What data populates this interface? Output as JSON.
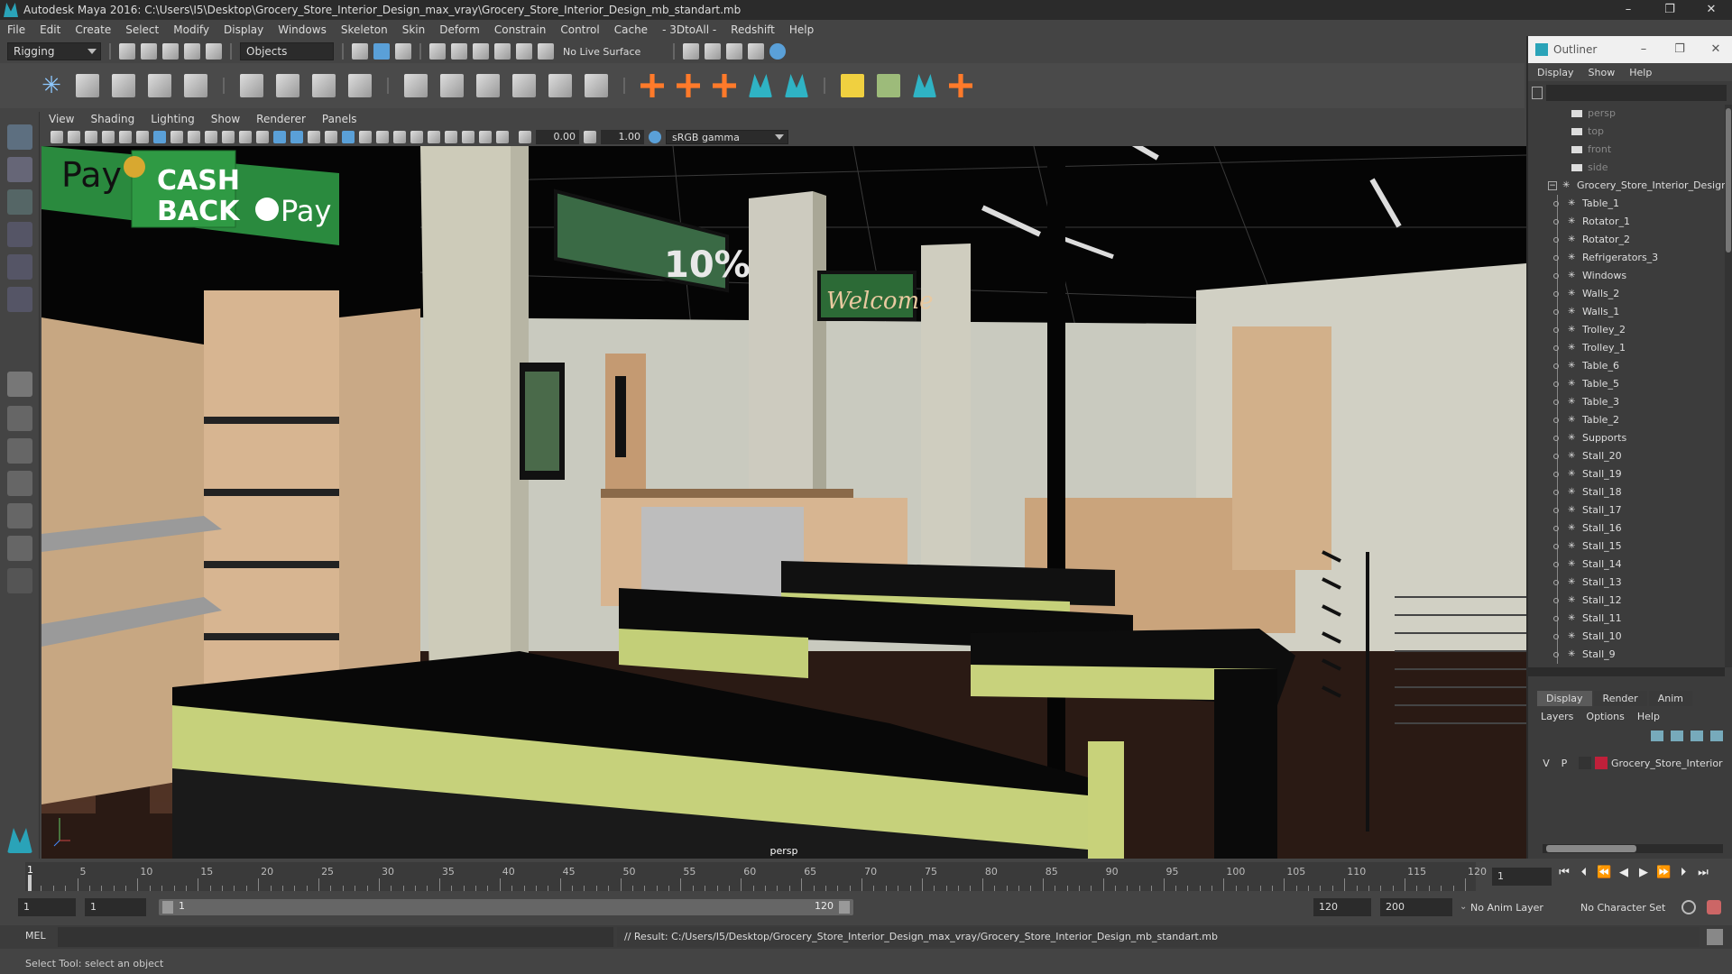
{
  "window": {
    "title": "Autodesk Maya 2016: C:\\Users\\I5\\Desktop\\Grocery_Store_Interior_Design_max_vray\\Grocery_Store_Interior_Design_mb_standart.mb",
    "minimize": "–",
    "maximize": "❐",
    "close": "✕"
  },
  "menubar": [
    "File",
    "Edit",
    "Create",
    "Select",
    "Modify",
    "Display",
    "Windows",
    "Skeleton",
    "Skin",
    "Deform",
    "Constrain",
    "Control",
    "Cache",
    "- 3DtoAll -",
    "Redshift",
    "Help"
  ],
  "statusline": {
    "menuset": "Rigging",
    "selection_mode": "Objects",
    "live_surface": "No Live Surface"
  },
  "viewport": {
    "menu": [
      "View",
      "Shading",
      "Lighting",
      "Show",
      "Renderer",
      "Panels"
    ],
    "exposure": "0.00",
    "gamma": "1.00",
    "color_space": "sRGB gamma",
    "camera_label": "persp",
    "scene_signs": {
      "cash": "CASH",
      "back": "BACK",
      "pay_left": "Pay",
      "gpay": "Pay",
      "percent": "10%",
      "welcome": "Welcome"
    }
  },
  "outliner": {
    "title": "Outliner",
    "menu": [
      "Display",
      "Show",
      "Help"
    ],
    "cameras": [
      "persp",
      "top",
      "front",
      "side"
    ],
    "root": "Grocery_Store_Interior_Design",
    "children": [
      "Table_1",
      "Rotator_1",
      "Rotator_2",
      "Refrigerators_3",
      "Windows",
      "Walls_2",
      "Walls_1",
      "Trolley_2",
      "Trolley_1",
      "Table_6",
      "Table_5",
      "Table_3",
      "Table_2",
      "Supports",
      "Stall_20",
      "Stall_19",
      "Stall_18",
      "Stall_17",
      "Stall_16",
      "Stall_15",
      "Stall_14",
      "Stall_13",
      "Stall_12",
      "Stall_11",
      "Stall_10",
      "Stall_9"
    ]
  },
  "layers": {
    "tabs": [
      "Display",
      "Render",
      "Anim"
    ],
    "menu": [
      "Layers",
      "Options",
      "Help"
    ],
    "row": {
      "v": "V",
      "p": "P",
      "name": "Grocery_Store_Interior"
    }
  },
  "timeline": {
    "ticks": [
      1,
      5,
      10,
      15,
      20,
      25,
      30,
      35,
      40,
      45,
      50,
      55,
      60,
      65,
      70,
      75,
      80,
      85,
      90,
      95,
      100,
      105,
      110,
      115,
      120
    ],
    "labels": [
      "5",
      "10",
      "15",
      "20",
      "25",
      "30",
      "35",
      "40",
      "45",
      "50",
      "55",
      "60",
      "65",
      "70",
      "75",
      "80",
      "85",
      "90",
      "95",
      "100",
      "105",
      "110",
      "115",
      "120"
    ],
    "current_frame_marker": "1",
    "current_frame": "1"
  },
  "range": {
    "start": "1",
    "playback_start": "1",
    "slider_start": "1",
    "slider_end": "120",
    "playback_end": "120",
    "end": "200",
    "anim_layer": "No Anim Layer",
    "character_set": "No Character Set"
  },
  "cmdline": {
    "lang": "MEL",
    "result": "// Result: C:/Users/I5/Desktop/Grocery_Store_Interior_Design_max_vray/Grocery_Store_Interior_Design_mb_standart.mb"
  },
  "helpline": "Select Tool: select an object"
}
